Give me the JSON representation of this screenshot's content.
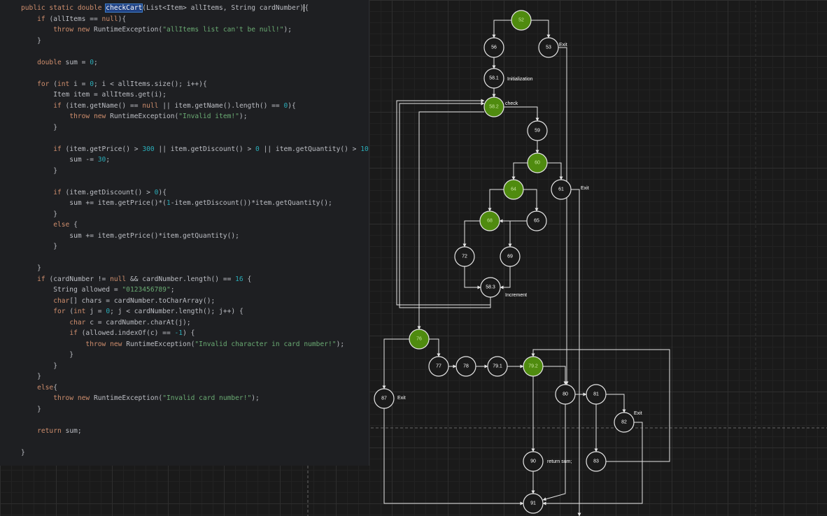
{
  "editor": {
    "lines": [
      [
        [
          "kw",
          "public static double "
        ],
        [
          "hl",
          "checkCart"
        ],
        [
          "",
          "(List<Item> allItems, String cardNumber)"
        ],
        [
          "caret",
          "{"
        ]
      ],
      [
        [
          "",
          "    "
        ],
        [
          "kw",
          "if"
        ],
        [
          "",
          " (allItems == "
        ],
        [
          "kw",
          "null"
        ],
        [
          "",
          "){"
        ]
      ],
      [
        [
          "",
          "        "
        ],
        [
          "kw",
          "throw new "
        ],
        [
          "",
          "RuntimeException("
        ],
        [
          "str",
          "\"allItems list can't be null!\""
        ],
        [
          "",
          ");"
        ]
      ],
      [
        [
          "",
          "    }"
        ]
      ],
      [
        [
          "",
          ""
        ]
      ],
      [
        [
          "",
          "    "
        ],
        [
          "kw",
          "double"
        ],
        [
          "",
          " sum = "
        ],
        [
          "num",
          "0"
        ],
        [
          "",
          ";"
        ]
      ],
      [
        [
          "",
          ""
        ]
      ],
      [
        [
          "",
          "    "
        ],
        [
          "kw",
          "for"
        ],
        [
          "",
          " ("
        ],
        [
          "kw",
          "int"
        ],
        [
          "",
          " i = "
        ],
        [
          "num",
          "0"
        ],
        [
          "",
          "; i < allItems.size(); i++){"
        ]
      ],
      [
        [
          "",
          "        Item item = allItems.get(i);"
        ]
      ],
      [
        [
          "",
          "        "
        ],
        [
          "kw",
          "if"
        ],
        [
          "",
          " (item.getName() == "
        ],
        [
          "kw",
          "null"
        ],
        [
          "",
          " || item.getName().length() == "
        ],
        [
          "num",
          "0"
        ],
        [
          "",
          "){"
        ]
      ],
      [
        [
          "",
          "            "
        ],
        [
          "kw",
          "throw new "
        ],
        [
          "",
          "RuntimeException("
        ],
        [
          "str",
          "\"Invalid item!\""
        ],
        [
          "",
          ");"
        ]
      ],
      [
        [
          "",
          "        }"
        ]
      ],
      [
        [
          "",
          ""
        ]
      ],
      [
        [
          "",
          "        "
        ],
        [
          "kw",
          "if"
        ],
        [
          "",
          " (item.getPrice() > "
        ],
        [
          "num",
          "300"
        ],
        [
          "",
          " || item.getDiscount() > "
        ],
        [
          "num",
          "0"
        ],
        [
          "",
          " || item.getQuantity() > "
        ],
        [
          "num",
          "10"
        ],
        [
          "",
          "){"
        ]
      ],
      [
        [
          "",
          "            sum -= "
        ],
        [
          "num",
          "30"
        ],
        [
          "",
          ";"
        ]
      ],
      [
        [
          "",
          "        }"
        ]
      ],
      [
        [
          "",
          ""
        ]
      ],
      [
        [
          "",
          "        "
        ],
        [
          "kw",
          "if"
        ],
        [
          "",
          " (item.getDiscount() > "
        ],
        [
          "num",
          "0"
        ],
        [
          "",
          "){"
        ]
      ],
      [
        [
          "",
          "            sum += item.getPrice()*("
        ],
        [
          "num",
          "1"
        ],
        [
          "",
          "-item.getDiscount())*item.getQuantity();"
        ]
      ],
      [
        [
          "",
          "        }"
        ]
      ],
      [
        [
          "",
          "        "
        ],
        [
          "kw",
          "else"
        ],
        [
          "",
          " {"
        ]
      ],
      [
        [
          "",
          "            sum += item.getPrice()*item.getQuantity();"
        ]
      ],
      [
        [
          "",
          "        }"
        ]
      ],
      [
        [
          "",
          ""
        ]
      ],
      [
        [
          "",
          "    }"
        ]
      ],
      [
        [
          "",
          "    "
        ],
        [
          "kw",
          "if"
        ],
        [
          "",
          " (cardNumber != "
        ],
        [
          "kw",
          "null"
        ],
        [
          "",
          " && cardNumber.length() == "
        ],
        [
          "num",
          "16"
        ],
        [
          "",
          " {"
        ]
      ],
      [
        [
          "",
          "        String allowed = "
        ],
        [
          "str",
          "\"0123456789\""
        ],
        [
          "",
          ";"
        ]
      ],
      [
        [
          "",
          "        "
        ],
        [
          "kw",
          "char"
        ],
        [
          "",
          "[] chars = cardNumber.toCharArray();"
        ]
      ],
      [
        [
          "",
          "        "
        ],
        [
          "kw",
          "for"
        ],
        [
          "",
          " ("
        ],
        [
          "kw",
          "int"
        ],
        [
          "",
          " j = "
        ],
        [
          "num",
          "0"
        ],
        [
          "",
          "; j < cardNumber.length(); j++) {"
        ]
      ],
      [
        [
          "",
          "            "
        ],
        [
          "kw",
          "char"
        ],
        [
          "",
          " c = cardNumber.charAt(j);"
        ]
      ],
      [
        [
          "",
          "            "
        ],
        [
          "kw",
          "if"
        ],
        [
          "",
          " (allowed.indexOf(c) == "
        ],
        [
          "num",
          "-1"
        ],
        [
          "",
          ") {"
        ]
      ],
      [
        [
          "",
          "                "
        ],
        [
          "kw",
          "throw new "
        ],
        [
          "",
          "RuntimeException("
        ],
        [
          "str",
          "\"Invalid character in card number!\""
        ],
        [
          "",
          ");"
        ]
      ],
      [
        [
          "",
          "            }"
        ]
      ],
      [
        [
          "",
          "        }"
        ]
      ],
      [
        [
          "",
          "    }"
        ]
      ],
      [
        [
          "",
          "    "
        ],
        [
          "kw",
          "else"
        ],
        [
          "",
          "{"
        ]
      ],
      [
        [
          "",
          "        "
        ],
        [
          "kw",
          "throw new "
        ],
        [
          "",
          "RuntimeException("
        ],
        [
          "str",
          "\"Invalid card number!\""
        ],
        [
          "",
          ");"
        ]
      ],
      [
        [
          "",
          "    }"
        ]
      ],
      [
        [
          "",
          ""
        ]
      ],
      [
        [
          "",
          "    "
        ],
        [
          "kw",
          "return"
        ],
        [
          "",
          " sum;"
        ]
      ],
      [
        [
          "",
          ""
        ]
      ],
      [
        [
          "",
          "}"
        ]
      ]
    ]
  },
  "graph": {
    "nodes": [
      {
        "id": "52",
        "green": true
      },
      {
        "id": "56"
      },
      {
        "id": "53"
      },
      {
        "id": "58.1"
      },
      {
        "id": "58.2",
        "green": true
      },
      {
        "id": "59"
      },
      {
        "id": "60",
        "green": true
      },
      {
        "id": "61"
      },
      {
        "id": "64",
        "green": true
      },
      {
        "id": "65"
      },
      {
        "id": "68",
        "green": true
      },
      {
        "id": "72"
      },
      {
        "id": "69"
      },
      {
        "id": "58.3"
      },
      {
        "id": "76",
        "green": true
      },
      {
        "id": "77"
      },
      {
        "id": "78"
      },
      {
        "id": "79.1"
      },
      {
        "id": "79.2",
        "green": true
      },
      {
        "id": "80"
      },
      {
        "id": "81"
      },
      {
        "id": "82"
      },
      {
        "id": "87"
      },
      {
        "id": "90"
      },
      {
        "id": "83"
      },
      {
        "id": "91"
      }
    ],
    "labels": {
      "exit_53": "Exit",
      "initialization": "Initialization",
      "check": "check",
      "exit_61": "Exit",
      "increment": "Increment",
      "exit_87": "Exit",
      "exit_82": "Exit",
      "return_sum": "return sum;"
    }
  }
}
